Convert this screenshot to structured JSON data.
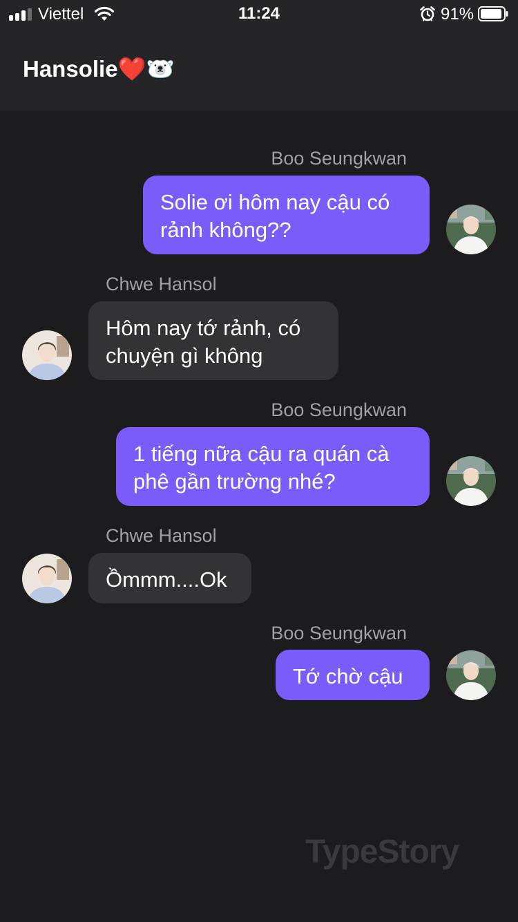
{
  "status_bar": {
    "carrier": "Viettel",
    "time": "11:24",
    "battery": "91%",
    "signal_bars_filled": 3,
    "signal_bars_total": 4
  },
  "header": {
    "title": "Hansolie❤️🐻‍❄️"
  },
  "messages": [
    {
      "sender": "Boo Seungkwan",
      "side": "right",
      "line1": "Solie ơi hôm nay cậu có",
      "line2": "rảnh không??"
    },
    {
      "sender": "Chwe Hansol",
      "side": "left",
      "line1": "Hôm nay tớ rảnh, có",
      "line2": "chuyện gì không"
    },
    {
      "sender": "Boo Seungkwan",
      "side": "right",
      "line1": "1 tiếng nữa cậu ra quán cà",
      "line2": "phê gần trường nhé?"
    },
    {
      "sender": "Chwe Hansol",
      "side": "left",
      "line1": "Ồmmm....Ok"
    },
    {
      "sender": "Boo Seungkwan",
      "side": "right",
      "line1": "Tớ chờ cậu"
    }
  ],
  "watermark": "TypeStory",
  "colors": {
    "background": "#1c1c1e",
    "header": "#252527",
    "outgoing_bubble": "#7a5cfa",
    "incoming_bubble": "#333337",
    "sender_name": "#a0a0a6",
    "watermark": "#3a3a3e"
  },
  "icons": [
    "signal-icon",
    "wifi-icon",
    "alarm-icon",
    "battery-icon"
  ]
}
